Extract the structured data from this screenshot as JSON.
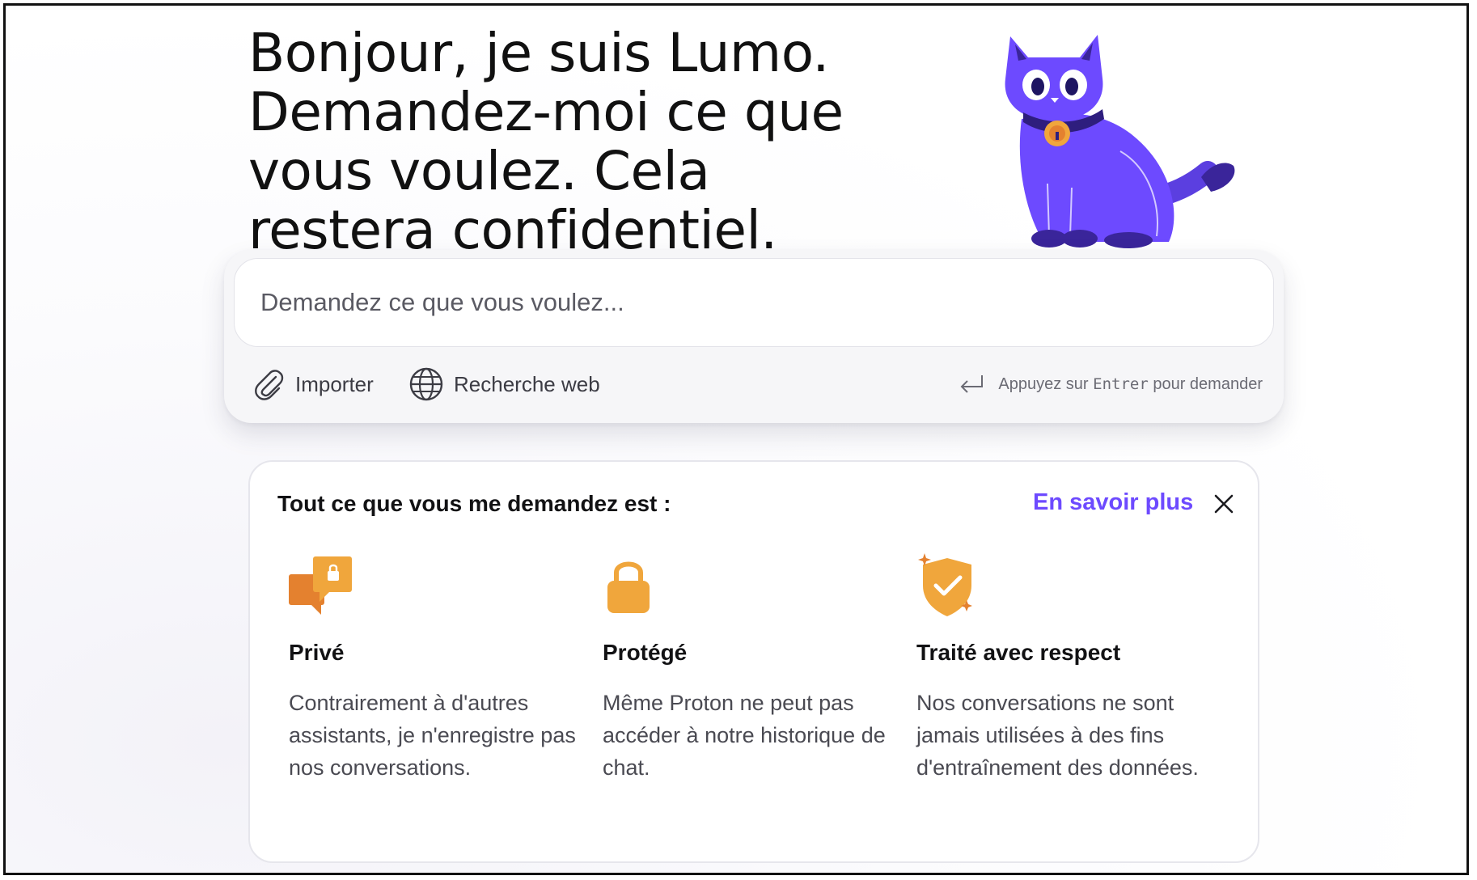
{
  "hero": {
    "title": "Bonjour, je suis Lumo. Demandez-moi ce que vous voulez. Cela restera confidentiel."
  },
  "mascot": {
    "name": "cat-mascot-icon",
    "color": "#6d4aff"
  },
  "composer": {
    "placeholder": "Demandez ce que vous voulez...",
    "tools": [
      {
        "icon": "paperclip-icon",
        "label": "Importer"
      },
      {
        "icon": "globe-icon",
        "label": "Recherche web"
      }
    ],
    "hint": {
      "icon": "enter-key-icon",
      "prefix": "Appuyez sur",
      "key": "Entrer",
      "suffix": "pour demander"
    }
  },
  "privacy_card": {
    "title": "Tout ce que vous me demandez est :",
    "learn_more": "En savoir plus",
    "close_icon": "close-icon",
    "features": [
      {
        "icon": "chat-lock-icon",
        "title": "Privé",
        "text": "Contrairement à d'autres assistants, je n'enregistre pas nos conversations."
      },
      {
        "icon": "padlock-icon",
        "title": "Protégé",
        "text": "Même Proton ne peut pas accéder à notre historique de chat."
      },
      {
        "icon": "shield-check-icon",
        "title": "Traité avec respect",
        "text": "Nos conversations ne sont jamais utilisées à des fins d'entraînement des données."
      }
    ]
  },
  "colors": {
    "accent": "#6d4aff",
    "icon_orange": "#f0a63c",
    "icon_orange_dark": "#e4812f"
  }
}
